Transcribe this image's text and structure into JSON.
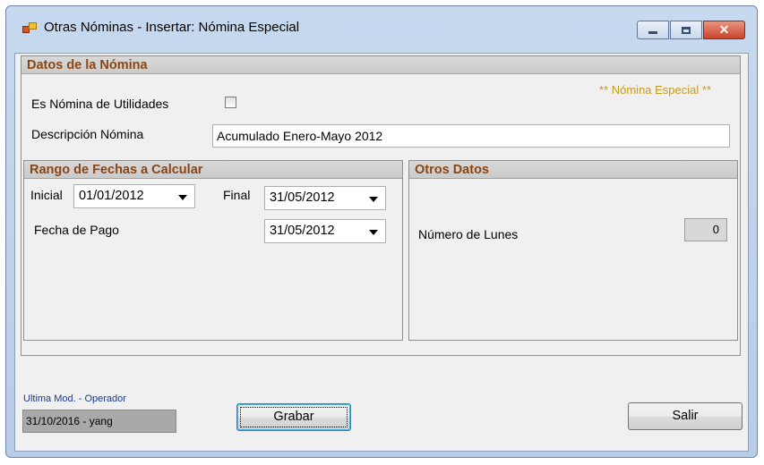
{
  "window": {
    "title": "Otras Nóminas - Insertar: Nómina Especial",
    "close_glyph": "✕"
  },
  "datos_nomina": {
    "header": "Datos de la Nómina",
    "es_utilidades_label": "Es Nómina de Utilidades",
    "es_utilidades_checked": false,
    "special_tag": "** Nómina Especial **",
    "descripcion_label": "Descripción Nómina",
    "descripcion_value": "Acumulado Enero-Mayo 2012"
  },
  "rango_fechas": {
    "header": "Rango de Fechas a Calcular",
    "inicial_label": "Inicial",
    "inicial_value": "01/01/2012",
    "final_label": "Final",
    "final_value": "31/05/2012",
    "fecha_pago_label": "Fecha de Pago",
    "fecha_pago_value": "31/05/2012"
  },
  "otros_datos": {
    "header": "Otros Datos",
    "numero_lunes_label": "Número de Lunes",
    "numero_lunes_value": "0"
  },
  "footer": {
    "ultima_mod_label": "Ultima Mod. - Operador",
    "ultima_mod_value": "31/10/2016 - yang",
    "grabar_label": "Grabar",
    "salir_label": "Salir"
  },
  "colors": {
    "group_header_text": "#8b4513",
    "special_tag": "#c79a1c",
    "footer_label": "#1f3a8a"
  }
}
